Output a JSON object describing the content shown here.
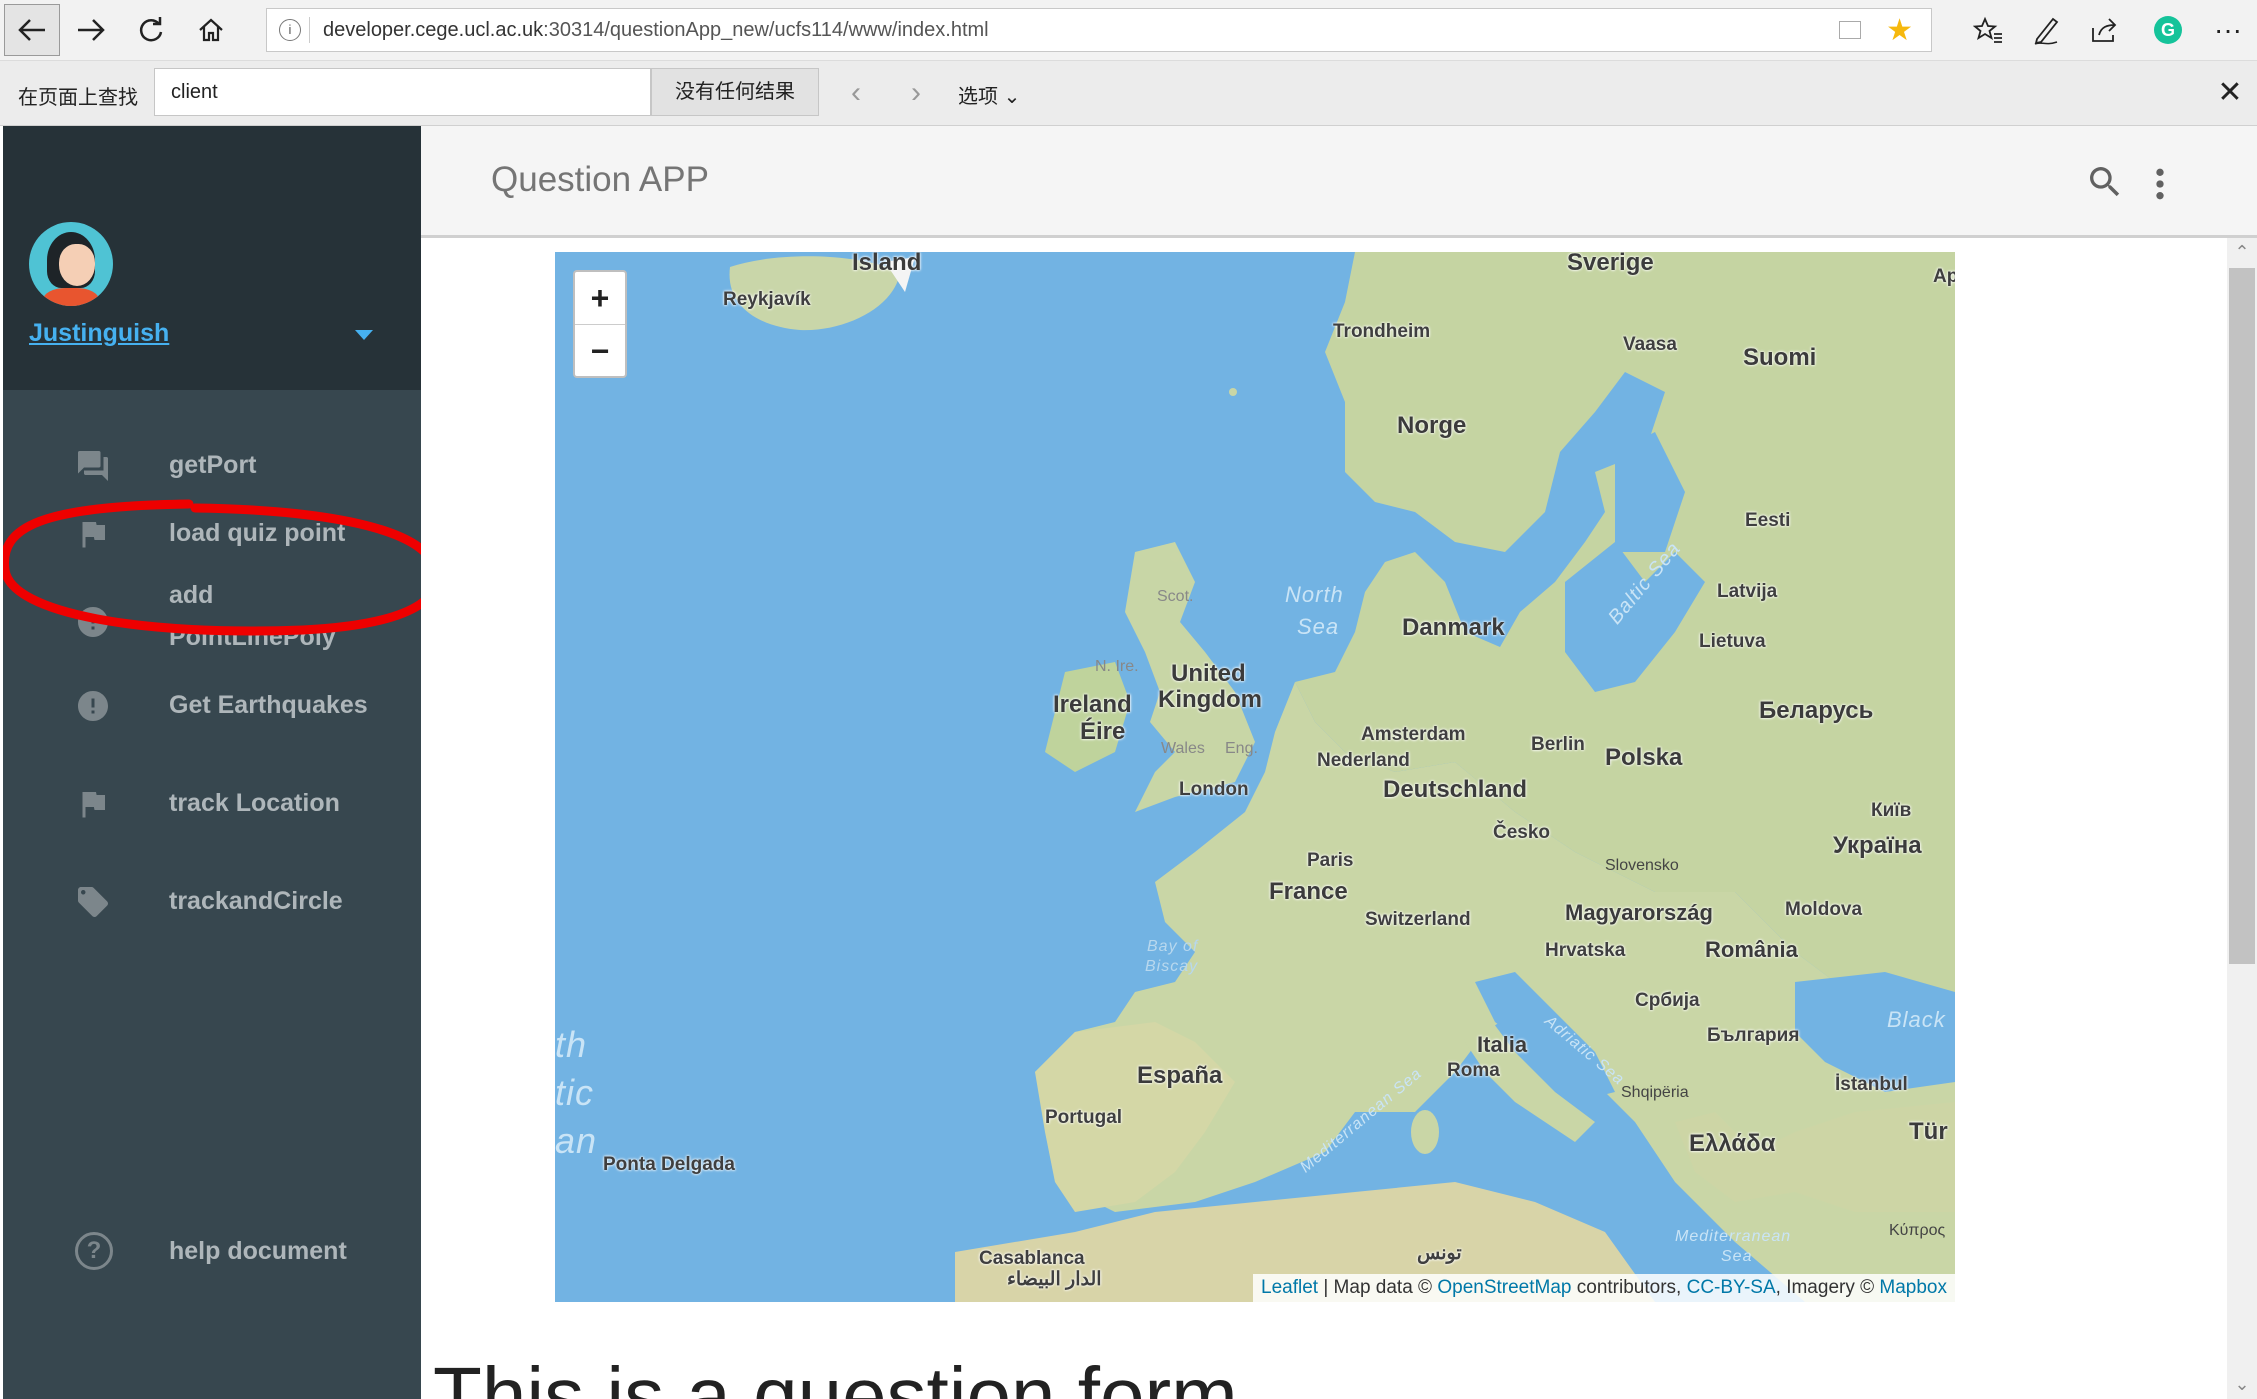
{
  "browser": {
    "url_host": "developer.cege.ucl.ac.uk",
    "url_path": ":30314/questionApp_new/ucfs114/www/index.html"
  },
  "find_bar": {
    "label": "在页面上查找",
    "query": "client",
    "status": "没有任何结果",
    "options_label": "选项"
  },
  "drawer": {
    "username": "Justinguish",
    "items": [
      {
        "label": "getPort",
        "icon": "forum-icon"
      },
      {
        "label": "load quiz point",
        "icon": "flag-icon"
      },
      {
        "label": "add",
        "label2": "PointLinePoly",
        "icon": "alert-circle-icon"
      },
      {
        "label": "Get Earthquakes",
        "icon": "alert-circle-icon"
      },
      {
        "label": "track Location",
        "icon": "flag-icon"
      },
      {
        "label": "trackandCircle",
        "icon": "tag-icon"
      }
    ],
    "help_label": "help document"
  },
  "app": {
    "title": "Question APP",
    "heading": "This is a question form"
  },
  "map": {
    "zoom_in": "+",
    "zoom_out": "−",
    "attribution": {
      "leaflet": "Leaflet",
      "map_data": " | Map data © ",
      "osm": "OpenStreetMap",
      "contributors": " contributors, ",
      "license": "CC-BY-SA",
      "imagery": ", Imagery © ",
      "provider": "Mapbox"
    },
    "labels": {
      "island": "Island",
      "reykjavik": "Reykjavík",
      "sverige": "Sverige",
      "trondheim": "Trondheim",
      "vaasa": "Vaasa",
      "suomi": "Suomi",
      "norge": "Norge",
      "eesti": "Eesti",
      "latvija": "Latvija",
      "lietuva": "Lietuva",
      "danmark": "Danmark",
      "north": "North",
      "sea": "Sea",
      "baltic": "Baltic Sea",
      "scot": "Scot.",
      "nire": "N. Ire.",
      "uk1": "United",
      "uk2": "Kingdom",
      "ireland": "Ireland",
      "eire": "Éire",
      "wales": "Wales",
      "eng": "Eng.",
      "london": "London",
      "amsterdam": "Amsterdam",
      "nederland": "Nederland",
      "berlin": "Berlin",
      "polska": "Polska",
      "belarus": "Беларусь",
      "deutschland": "Deutschland",
      "kyiv": "Київ",
      "cesko": "Česko",
      "ukraina": "Україна",
      "slovensko": "Slovensko",
      "paris": "Paris",
      "france": "France",
      "switzerland": "Switzerland",
      "magyar": "Magyarország",
      "moldova": "Moldova",
      "hrvatska": "Hrvatska",
      "romania": "România",
      "bay1": "Bay of",
      "bay2": "Biscay",
      "srbija": "Србија",
      "balgaria": "България",
      "black": "Black",
      "espana": "España",
      "italia": "Italia",
      "roma": "Roma",
      "adriatic": "Adriatic Sea",
      "shqiperia": "Shqipëria",
      "istanbul": "İstanbul",
      "portugal": "Portugal",
      "ellada": "Ελλάδα",
      "tur": "Tür",
      "ponta": "Ponta Delgada",
      "medsea": "Mediterranean Sea",
      "medsea2": "Mediterranean",
      "sea2": "Sea",
      "kypros": "Κύπρος",
      "casablanca": "Casablanca",
      "casa_ar": "الدار البيضاء",
      "tunis": "تونس",
      "ap": "Ap",
      "th": "th",
      "tic": "tic",
      "an": "an"
    }
  }
}
